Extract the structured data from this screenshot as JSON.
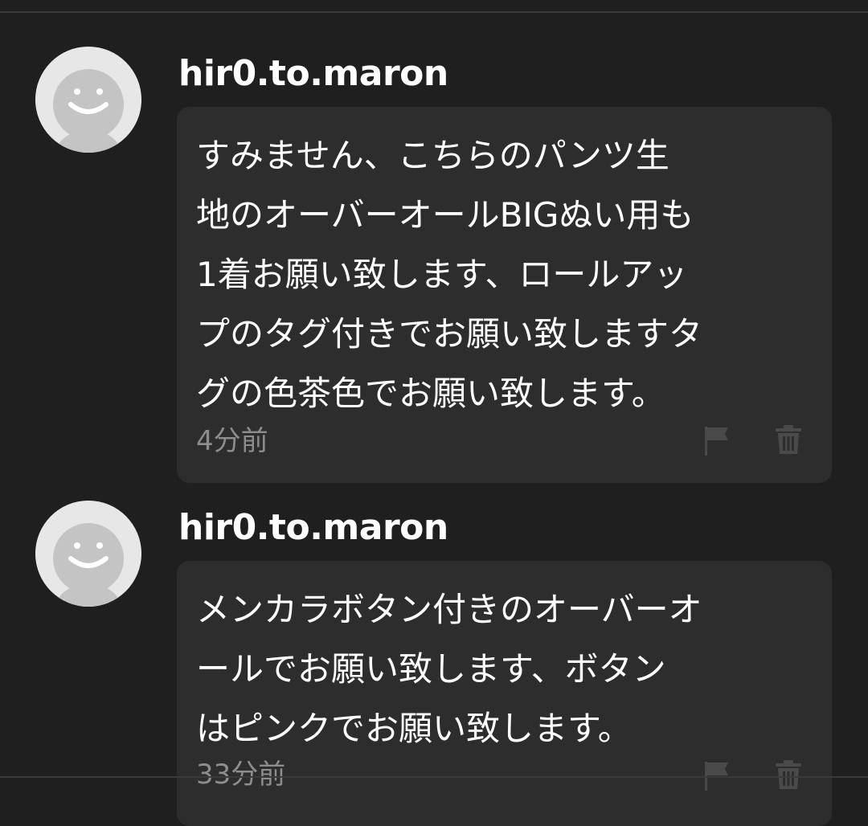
{
  "comments": [
    {
      "username": "hir0.to.maron",
      "message": "すみません、こちらのパンツ生\n地のオーバーオールBIGぬい用も\n1着お願い致します、ロールアッ\nプのタグ付きでお願い致しますタ\nグの色茶色でお願い致します。",
      "time": "4分前",
      "avatar_icon": "default-user-avatar-icon",
      "flag_icon": "flag-icon",
      "trash_icon": "trash-icon"
    },
    {
      "username": "hir0.to.maron",
      "message": "メンカラボタン付きのオーバーオ\nールでお願い致します、ボタン\nはピンクでお願い致します。",
      "time": "33分前",
      "avatar_icon": "default-user-avatar-icon",
      "flag_icon": "flag-icon",
      "trash_icon": "trash-icon"
    }
  ],
  "colors": {
    "background": "#1f1f1f",
    "bubble": "#2d2d2d",
    "text": "#ffffff",
    "muted": "#8d8d8d",
    "avatar_bg": "#e8e7e7",
    "avatar_figure": "#c4c4c4"
  }
}
